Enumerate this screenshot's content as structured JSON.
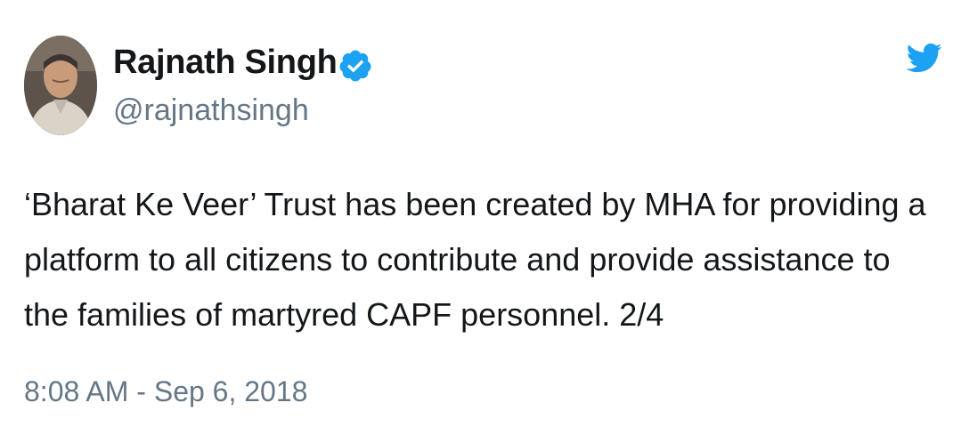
{
  "author": {
    "display_name": "Rajnath Singh",
    "handle": "@rajnathsingh",
    "verified": true,
    "avatar_icon": "profile-photo"
  },
  "tweet": {
    "text_lines": [
      "‘Bharat Ke Veer’ Trust has been created by MHA for providing a",
      "platform to all citizens to contribute and provide assistance to",
      "the families of martyred CAPF personnel. 2/4"
    ],
    "timestamp": "8:08 AM - Sep 6, 2018"
  },
  "icons": {
    "verified": "verified-badge-icon",
    "brand": "twitter-bird-icon"
  },
  "colors": {
    "brand_blue": "#1da1f2",
    "text_primary": "#14171a",
    "text_secondary": "#657786",
    "background": "#ffffff"
  }
}
